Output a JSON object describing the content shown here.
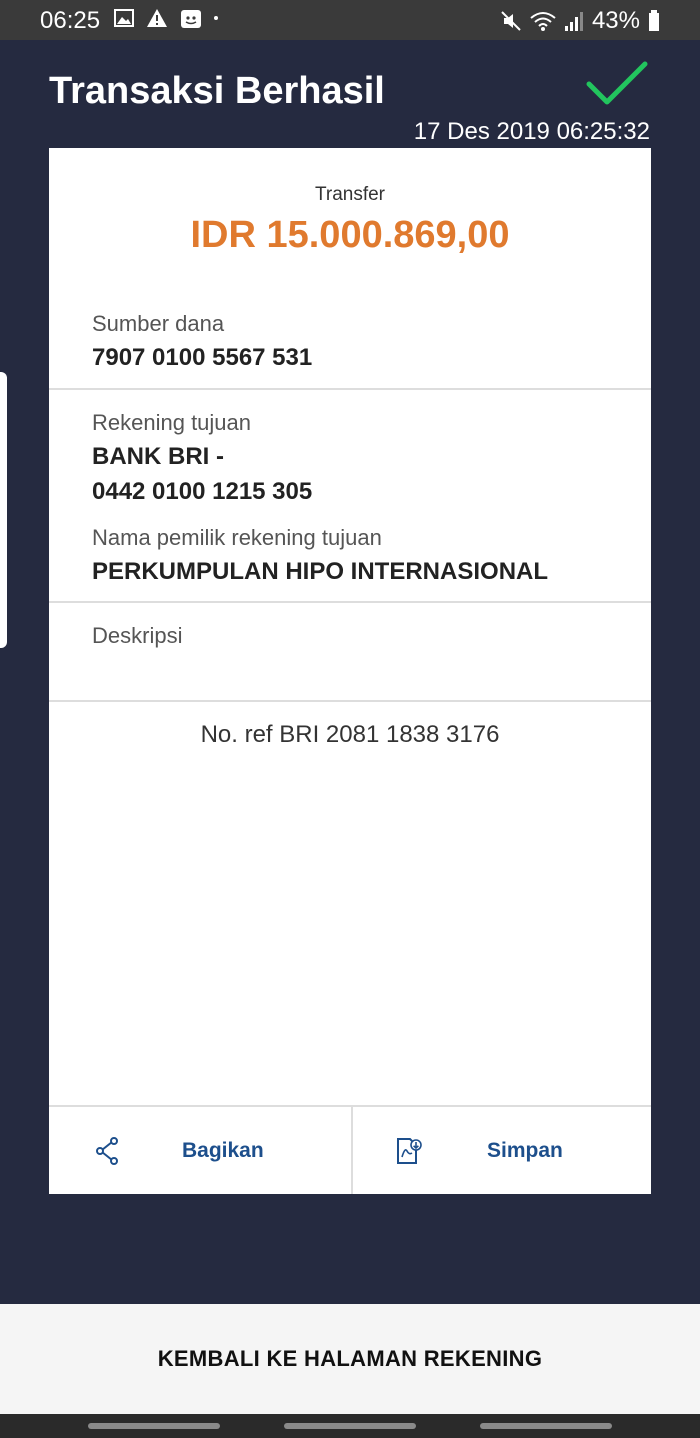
{
  "status_bar": {
    "time": "06:25",
    "battery": "43%",
    "icons_left": [
      "image-icon",
      "warning-icon",
      "notification-icon"
    ],
    "icons_right": [
      "mute-icon",
      "wifi-icon",
      "signal-icon",
      "battery-icon"
    ]
  },
  "header": {
    "title": "Transaksi Berhasil",
    "datetime": "17 Des 2019 06:25:32",
    "success_icon": "check-icon",
    "success_color": "#22c55e"
  },
  "receipt": {
    "type_label": "Transfer",
    "amount": "IDR 15.000.869,00",
    "amount_color": "#e07a2e",
    "source_label": "Sumber dana",
    "source_value": "7907 0100 5567 531",
    "dest_label": "Rekening tujuan",
    "dest_bank": "BANK BRI -",
    "dest_account": "0442 0100 1215 305",
    "owner_label": "Nama pemilik rekening tujuan",
    "owner_value": "PERKUMPULAN HIPO INTERNASIONAL",
    "desc_label": "Deskripsi",
    "desc_value": "",
    "ref": "No. ref BRI 2081 1838 3176"
  },
  "actions": {
    "share_label": "Bagikan",
    "share_icon": "share-icon",
    "save_label": "Simpan",
    "save_icon": "pdf-download-icon",
    "accent_color": "#1d4f8c"
  },
  "bottom": {
    "back_label": "KEMBALI KE HALAMAN REKENING"
  }
}
